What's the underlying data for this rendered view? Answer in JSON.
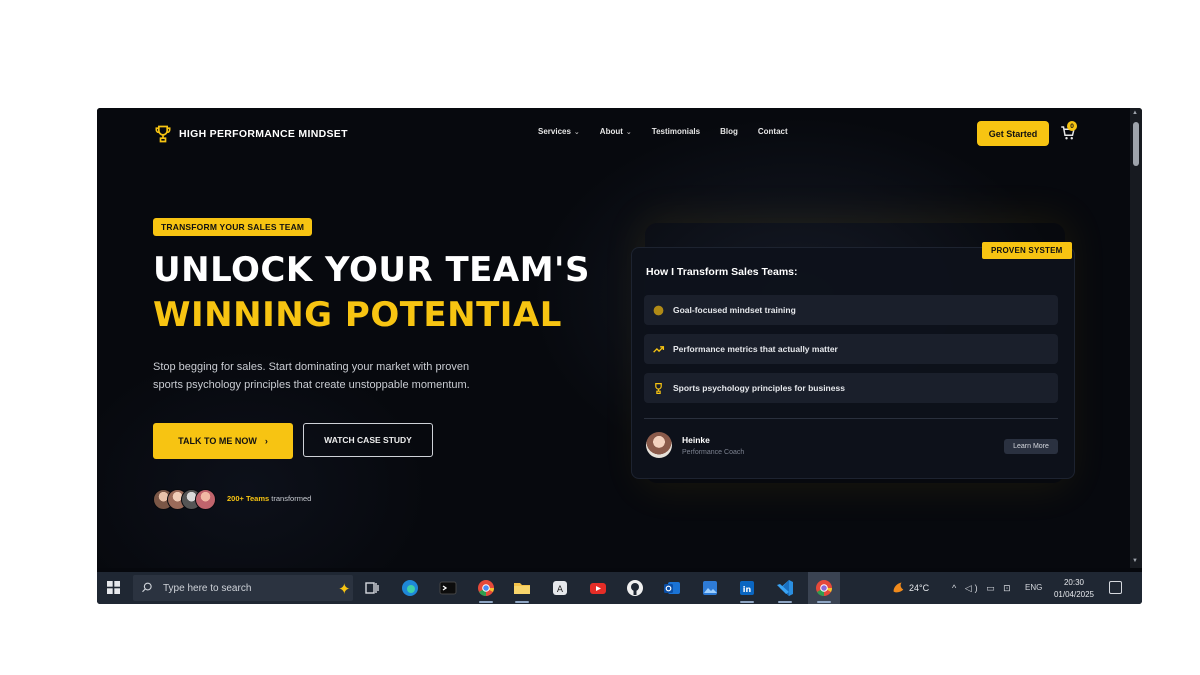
{
  "nav": {
    "logo_text": "HIGH PERFORMANCE MINDSET",
    "items": [
      {
        "label": "Services",
        "has_dropdown": true
      },
      {
        "label": "About",
        "has_dropdown": true
      },
      {
        "label": "Testimonials",
        "has_dropdown": false
      },
      {
        "label": "Blog",
        "has_dropdown": false
      },
      {
        "label": "Contact",
        "has_dropdown": false
      }
    ],
    "cta_label": "Get Started",
    "cart_count": "0"
  },
  "hero": {
    "badge": "TRANSFORM YOUR SALES TEAM",
    "title_line1": "UNLOCK YOUR TEAM'S",
    "title_line2": "WINNING POTENTIAL",
    "subtitle": "Stop begging for sales. Start dominating your market with proven sports psychology principles that create unstoppable momentum.",
    "primary_button": "TALK TO ME NOW",
    "secondary_button": "WATCH CASE STUDY",
    "teams_count": "200+ Teams",
    "teams_suffix": "transformed"
  },
  "card": {
    "badge": "PROVEN SYSTEM",
    "title": "How I Transform Sales Teams:",
    "items": [
      {
        "icon": "target-icon",
        "label": "Goal-focused mindset training"
      },
      {
        "icon": "trending-up-icon",
        "label": "Performance metrics that actually matter"
      },
      {
        "icon": "trophy-icon",
        "label": "Sports psychology principles for business"
      }
    ],
    "coach_name": "Heinke",
    "coach_role": "Performance Coach",
    "learn_more": "Learn More"
  },
  "taskbar": {
    "search_placeholder": "Type here to search",
    "apps": [
      "task-view-icon",
      "edge-icon",
      "terminal-icon",
      "chrome-icon",
      "file-explorer-icon",
      "app-icon",
      "youtube-icon",
      "github-icon",
      "outlook-icon",
      "photos-icon",
      "linkedin-icon",
      "vscode-icon",
      "chrome-active-icon"
    ],
    "temperature": "24°C",
    "language": "ENG",
    "time": "20:30",
    "date": "01/04/2025"
  },
  "colors": {
    "accent": "#f7c412",
    "background": "#07090e",
    "card": "#0e121b",
    "taskbar": "#1f2733"
  }
}
